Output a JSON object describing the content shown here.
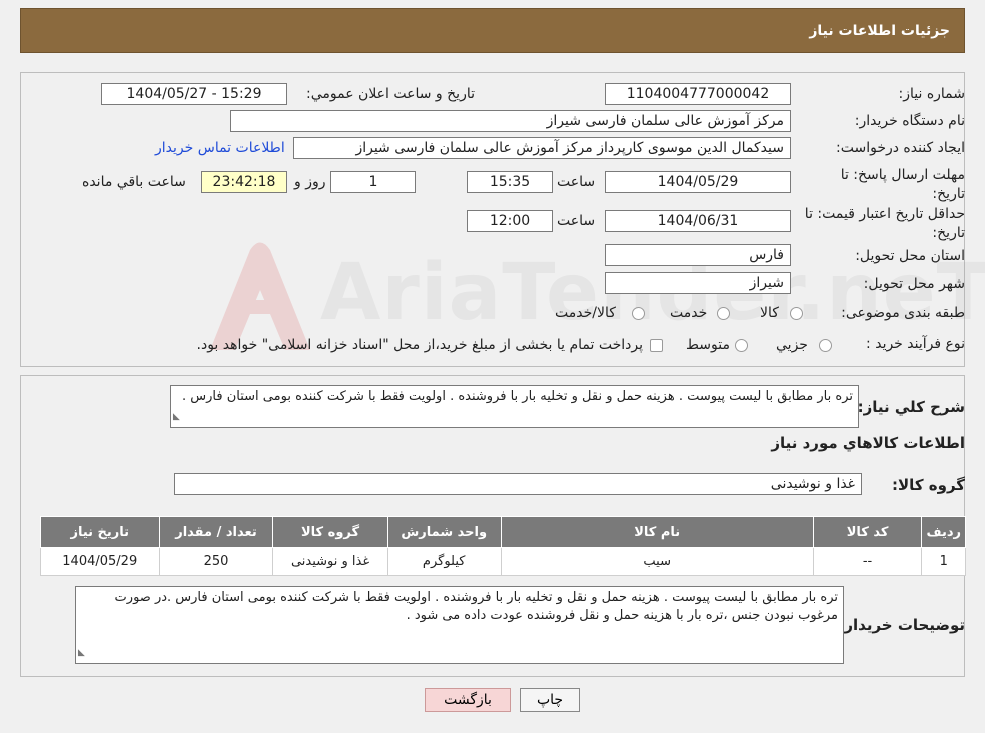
{
  "header": {
    "title": "جزئیات اطلاعات نیاز"
  },
  "fields": {
    "need_number": {
      "label": "شماره نیاز:",
      "value": "1104004777000042"
    },
    "announce_datetime": {
      "label": "تاریخ و ساعت اعلان عمومي:",
      "value": "1404/05/27 - 15:29"
    },
    "buyer_org": {
      "label": "نام دستگاه خریدار:",
      "value": "مرکز آموزش عالی سلمان فارسی شیراز"
    },
    "requester": {
      "label": "ایجاد کننده درخواست:",
      "value": "سیدکمال الدین موسوی کارپرداز مرکز آموزش عالی سلمان فارسی شیراز",
      "contact_link": "اطلاعات تماس خریدار"
    },
    "reply_deadline": {
      "label": "مهلت ارسال پاسخ: تا تاریخ:",
      "date": "1404/05/29",
      "time_label": "ساعت",
      "time": "15:35",
      "days": "1",
      "days_label": "روز و",
      "remaining": "23:42:18",
      "remaining_label": "ساعت باقي مانده"
    },
    "price_validity": {
      "label": "حداقل تاریخ اعتبار قیمت: تا تاریخ:",
      "date": "1404/06/31",
      "time_label": "ساعت",
      "time": "12:00"
    },
    "province": {
      "label": "استان محل تحویل:",
      "value": "فارس"
    },
    "city": {
      "label": "شهر محل تحویل:",
      "value": "شیراز"
    },
    "category": {
      "label": "طبقه بندی موضوعی:",
      "options": [
        "کالا",
        "خدمت",
        "کالا/خدمت"
      ]
    },
    "purchase_type": {
      "label": "نوع فرآیند خرید :",
      "options": [
        "جزیي",
        "متوسط"
      ],
      "note": "پرداخت تمام یا بخشی از مبلغ خرید،از محل \"اسناد خزانه اسلامی\" خواهد بود."
    }
  },
  "summary": {
    "label": "شرح کلي نیاز:",
    "text": "تره بار مطابق با لیست پیوست . هزینه حمل و نقل و تخلیه بار با فروشنده . اولویت فقط با شرکت کننده بومی استان فارس ."
  },
  "goods_section": {
    "title": "اطلاعات کالاهاي مورد نیاز",
    "group_label": "گروه کالا:",
    "group_value": "غذا و نوشیدنی"
  },
  "table": {
    "headers": [
      "ردیف",
      "کد کالا",
      "نام کالا",
      "واحد شمارش",
      "گروه کالا",
      "تعداد / مقدار",
      "تاریخ نیاز"
    ],
    "rows": [
      [
        "1",
        "--",
        "سیب",
        "کیلوگرم",
        "غذا و نوشیدنی",
        "250",
        "1404/05/29"
      ]
    ]
  },
  "buyer_notes": {
    "label": "توضیحات خریدار:",
    "text": "تره بار مطابق با لیست پیوست . هزینه حمل و نقل و تخلیه بار با فروشنده . اولویت فقط با شرکت کننده بومی استان فارس .در صورت مرغوب نبودن جنس ،تره بار با هزینه حمل و نقل فروشنده عودت داده می شود ."
  },
  "buttons": {
    "print": "چاپ",
    "back": "بازگشت"
  },
  "watermark": {
    "text": "AriaTender.neT"
  },
  "colors": {
    "header_bg": "#8b6a3e",
    "table_header_bg": "#7a7a7a",
    "remaining_bg": "#ffffc8",
    "link": "#1f4bd8"
  }
}
